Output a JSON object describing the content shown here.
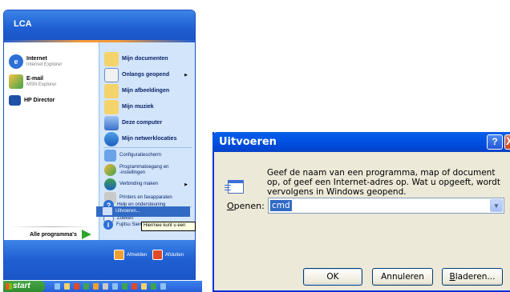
{
  "start_menu": {
    "user_name": "LCA",
    "pinned": [
      {
        "title": "Internet",
        "subtitle": "Internet Explorer",
        "icon": "internet-explorer-icon"
      },
      {
        "title": "E-mail",
        "subtitle": "MSN Explorer",
        "icon": "msn-explorer-icon"
      },
      {
        "title": "HP Director",
        "subtitle": "",
        "icon": "hp-director-icon"
      }
    ],
    "all_programs": "Alle programma's",
    "places": [
      {
        "label": "Mijn documenten",
        "icon": "folder-icon"
      },
      {
        "label": "Onlangs geopend",
        "icon": "recent-documents-icon"
      },
      {
        "label": "Mijn afbeeldingen",
        "icon": "pictures-folder-icon"
      },
      {
        "label": "Mijn muziek",
        "icon": "music-folder-icon"
      },
      {
        "label": "Deze computer",
        "icon": "computer-icon"
      },
      {
        "label": "Mijn netwerklocaties",
        "icon": "network-icon"
      }
    ],
    "system": [
      {
        "label": "Configuratiescherm",
        "icon": "control-panel-icon"
      },
      {
        "label": "Programmatoegang en -instellingen",
        "line1": "Programmatoegang en",
        "line2": "-instellingen",
        "icon": "program-access-icon"
      },
      {
        "label": "Verbinding maken",
        "icon": "connect-icon"
      },
      {
        "label": "Printers en faxapparaten",
        "icon": "printer-icon"
      },
      {
        "label": "Help en ondersteuning",
        "icon": "help-icon"
      },
      {
        "label": "Zoeken",
        "icon": "search-icon"
      },
      {
        "label": "Uitvoeren...",
        "icon": "run-icon"
      },
      {
        "label": "Fujitsu Siem",
        "icon": "fujitsu-icon"
      }
    ],
    "tooltip": "Hiermee kunt u een",
    "logoff": "Afmelden",
    "shutdown": "Afsluiten",
    "start_button": "start"
  },
  "run_dialog": {
    "title": "Uitvoeren",
    "help": "?",
    "close": "X",
    "description": "Geef de naam van een programma, map of document op, of geef een Internet-adres op. Wat u opgeeft, wordt vervolgens in Windows geopend.",
    "open_label_accel": "O",
    "open_label_rest": "penen:",
    "open_value": "cmd",
    "ok": "OK",
    "cancel": "Annuleren",
    "browse_accel": "B",
    "browse_rest": "laderen..."
  },
  "colors": {
    "xp_blue": "#0055e5",
    "highlight": "#316ac5",
    "dialog_bg": "#ece9d8",
    "close_red": "#c8451f"
  }
}
